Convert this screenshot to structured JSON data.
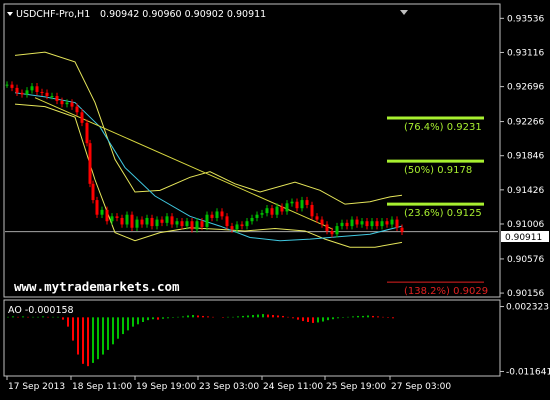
{
  "window": {
    "symbol": "USDCHF-Pro,H1",
    "ohlc": "0.90942 0.90960 0.90902 0.90911",
    "watermark": "www.mytrademarkets.com"
  },
  "colors": {
    "background": "#000000",
    "frame": "#c0c0c0",
    "bull": "#00c000",
    "bear": "#ff0000",
    "bands": "#e6e65a",
    "ma": "#40c8e0",
    "trendline": "#d8d840",
    "fib_level": "#a8f030",
    "fib_ext": "#e02020",
    "price_line": "#c0c0c0"
  },
  "chart_data": [
    {
      "type": "candlestick",
      "title": "USDCHF-Pro,H1",
      "y_ticks": [
        "0.93536",
        "0.93116",
        "0.92696",
        "0.92266",
        "0.91846",
        "0.91426",
        "0.91006",
        "0.90576",
        "0.90156"
      ],
      "ylim": [
        0.9012,
        0.937
      ],
      "x_ticks": [
        "17 Sep 2013",
        "18 Sep 11:00",
        "19 Sep 19:00",
        "23 Sep 03:00",
        "24 Sep 11:00",
        "25 Sep 19:00",
        "27 Sep 03:00"
      ],
      "current_price": "0.90911",
      "price_series": [
        {
          "x": 0,
          "c": 0.9272
        },
        {
          "x": 5,
          "c": 0.9268
        },
        {
          "x": 10,
          "c": 0.9262
        },
        {
          "x": 15,
          "c": 0.926
        },
        {
          "x": 20,
          "c": 0.9265
        },
        {
          "x": 25,
          "c": 0.927
        },
        {
          "x": 30,
          "c": 0.9263
        },
        {
          "x": 35,
          "c": 0.9262
        },
        {
          "x": 40,
          "c": 0.9258
        },
        {
          "x": 45,
          "c": 0.9258
        },
        {
          "x": 50,
          "c": 0.9252
        },
        {
          "x": 55,
          "c": 0.9248
        },
        {
          "x": 60,
          "c": 0.925
        },
        {
          "x": 65,
          "c": 0.9245
        },
        {
          "x": 70,
          "c": 0.9238
        },
        {
          "x": 75,
          "c": 0.9225
        },
        {
          "x": 80,
          "c": 0.92
        },
        {
          "x": 83,
          "c": 0.915
        },
        {
          "x": 86,
          "c": 0.913
        },
        {
          "x": 90,
          "c": 0.9112
        },
        {
          "x": 95,
          "c": 0.9118
        },
        {
          "x": 100,
          "c": 0.9104
        },
        {
          "x": 105,
          "c": 0.911
        },
        {
          "x": 110,
          "c": 0.9108
        },
        {
          "x": 115,
          "c": 0.91
        },
        {
          "x": 120,
          "c": 0.9112
        },
        {
          "x": 125,
          "c": 0.9096
        },
        {
          "x": 130,
          "c": 0.9106
        },
        {
          "x": 135,
          "c": 0.91
        },
        {
          "x": 140,
          "c": 0.9108
        },
        {
          "x": 145,
          "c": 0.9098
        },
        {
          "x": 150,
          "c": 0.9106
        },
        {
          "x": 155,
          "c": 0.9102
        },
        {
          "x": 160,
          "c": 0.911
        },
        {
          "x": 165,
          "c": 0.91
        },
        {
          "x": 170,
          "c": 0.9104
        },
        {
          "x": 175,
          "c": 0.9098
        },
        {
          "x": 180,
          "c": 0.9104
        },
        {
          "x": 185,
          "c": 0.9094
        },
        {
          "x": 190,
          "c": 0.9104
        },
        {
          "x": 195,
          "c": 0.9097
        },
        {
          "x": 200,
          "c": 0.9112
        },
        {
          "x": 205,
          "c": 0.9108
        },
        {
          "x": 210,
          "c": 0.9116
        },
        {
          "x": 215,
          "c": 0.911
        },
        {
          "x": 220,
          "c": 0.9098
        },
        {
          "x": 225,
          "c": 0.9094
        },
        {
          "x": 230,
          "c": 0.91
        },
        {
          "x": 235,
          "c": 0.9098
        },
        {
          "x": 240,
          "c": 0.9104
        },
        {
          "x": 245,
          "c": 0.9108
        },
        {
          "x": 250,
          "c": 0.9112
        },
        {
          "x": 255,
          "c": 0.9114
        },
        {
          "x": 260,
          "c": 0.912
        },
        {
          "x": 265,
          "c": 0.9112
        },
        {
          "x": 270,
          "c": 0.9122
        },
        {
          "x": 275,
          "c": 0.9116
        },
        {
          "x": 280,
          "c": 0.9126
        },
        {
          "x": 285,
          "c": 0.9128
        },
        {
          "x": 290,
          "c": 0.912
        },
        {
          "x": 295,
          "c": 0.913
        },
        {
          "x": 300,
          "c": 0.9124
        },
        {
          "x": 305,
          "c": 0.911
        },
        {
          "x": 310,
          "c": 0.9106
        },
        {
          "x": 315,
          "c": 0.91
        },
        {
          "x": 320,
          "c": 0.9092
        },
        {
          "x": 325,
          "c": 0.9088
        },
        {
          "x": 330,
          "c": 0.9098
        },
        {
          "x": 335,
          "c": 0.9102
        },
        {
          "x": 340,
          "c": 0.9098
        },
        {
          "x": 345,
          "c": 0.9106
        },
        {
          "x": 350,
          "c": 0.91
        },
        {
          "x": 355,
          "c": 0.9104
        },
        {
          "x": 360,
          "c": 0.9098
        },
        {
          "x": 365,
          "c": 0.9104
        },
        {
          "x": 370,
          "c": 0.9098
        },
        {
          "x": 375,
          "c": 0.9104
        },
        {
          "x": 380,
          "c": 0.91
        },
        {
          "x": 385,
          "c": 0.9106
        },
        {
          "x": 390,
          "c": 0.9096
        },
        {
          "x": 395,
          "c": 0.9091
        }
      ],
      "upper_band": [
        {
          "x": 10,
          "v": 0.9308
        },
        {
          "x": 40,
          "v": 0.9312
        },
        {
          "x": 70,
          "v": 0.93
        },
        {
          "x": 90,
          "v": 0.925
        },
        {
          "x": 110,
          "v": 0.918
        },
        {
          "x": 130,
          "v": 0.914
        },
        {
          "x": 155,
          "v": 0.9142
        },
        {
          "x": 185,
          "v": 0.9158
        },
        {
          "x": 205,
          "v": 0.9165
        },
        {
          "x": 230,
          "v": 0.915
        },
        {
          "x": 255,
          "v": 0.914
        },
        {
          "x": 290,
          "v": 0.9152
        },
        {
          "x": 315,
          "v": 0.9142
        },
        {
          "x": 340,
          "v": 0.9125
        },
        {
          "x": 365,
          "v": 0.9128
        },
        {
          "x": 385,
          "v": 0.9134
        },
        {
          "x": 397,
          "v": 0.9136
        }
      ],
      "lower_band": [
        {
          "x": 10,
          "v": 0.9248
        },
        {
          "x": 40,
          "v": 0.9245
        },
        {
          "x": 70,
          "v": 0.9232
        },
        {
          "x": 90,
          "v": 0.9155
        },
        {
          "x": 110,
          "v": 0.909
        },
        {
          "x": 130,
          "v": 0.908
        },
        {
          "x": 155,
          "v": 0.909
        },
        {
          "x": 185,
          "v": 0.9096
        },
        {
          "x": 215,
          "v": 0.9094
        },
        {
          "x": 240,
          "v": 0.9092
        },
        {
          "x": 270,
          "v": 0.9095
        },
        {
          "x": 300,
          "v": 0.9092
        },
        {
          "x": 320,
          "v": 0.9082
        },
        {
          "x": 345,
          "v": 0.9072
        },
        {
          "x": 370,
          "v": 0.9072
        },
        {
          "x": 397,
          "v": 0.9078
        }
      ],
      "moving_average": [
        {
          "x": 10,
          "v": 0.9262
        },
        {
          "x": 40,
          "v": 0.9257
        },
        {
          "x": 70,
          "v": 0.925
        },
        {
          "x": 95,
          "v": 0.922
        },
        {
          "x": 120,
          "v": 0.917
        },
        {
          "x": 150,
          "v": 0.9135
        },
        {
          "x": 185,
          "v": 0.911
        },
        {
          "x": 215,
          "v": 0.9098
        },
        {
          "x": 245,
          "v": 0.9084
        },
        {
          "x": 275,
          "v": 0.908
        },
        {
          "x": 305,
          "v": 0.9082
        },
        {
          "x": 335,
          "v": 0.9085
        },
        {
          "x": 365,
          "v": 0.9088
        },
        {
          "x": 397,
          "v": 0.9098
        }
      ],
      "trendline": [
        {
          "x": 30,
          "v": 0.9256
        },
        {
          "x": 328,
          "v": 0.9094
        }
      ],
      "fibonacci_levels": [
        {
          "label": "(76.4%) 0.9231",
          "value": 0.9231,
          "x_start": 385
        },
        {
          "label": "(50%) 0.9178",
          "value": 0.9178,
          "x_start": 385
        },
        {
          "label": "(23.6%) 0.9125",
          "value": 0.9125,
          "x_start": 385
        },
        {
          "label": "(138.2%) 0.9029",
          "value": 0.9029,
          "x_start": 385
        }
      ]
    },
    {
      "type": "bar",
      "title": "AO -0.000158",
      "y_ticks": [
        "0.002323",
        "-0.011641"
      ],
      "ylim": [
        -0.0124,
        0.0033
      ],
      "values": [
        0.0001,
        0.0002,
        0.0001,
        0.0002,
        0.0001,
        0.0001,
        0.0001,
        0.0002,
        0.0001,
        0.0001,
        0.0001,
        -0.0005,
        -0.002,
        -0.005,
        -0.008,
        -0.01,
        -0.0105,
        -0.0098,
        -0.009,
        -0.008,
        -0.007,
        -0.0058,
        -0.0046,
        -0.0036,
        -0.0028,
        -0.002,
        -0.0015,
        -0.001,
        -0.0006,
        -0.0004,
        -0.0005,
        -0.0003,
        -0.0002,
        -0.0001,
        0.0001,
        0.0002,
        0.0004,
        0.0005,
        0.0004,
        0.0003,
        0.0002,
        0.0001,
        0.0,
        -0.0001,
        0.0001,
        0.0001,
        0.0002,
        0.0003,
        0.0004,
        0.0005,
        0.0006,
        0.0007,
        0.0006,
        0.0005,
        0.0004,
        0.0003,
        0.0001,
        -0.0002,
        -0.0005,
        -0.0008,
        -0.001,
        -0.0012,
        -0.0011,
        -0.0009,
        -0.0006,
        -0.0004,
        -0.0002,
        -0.0001,
        0.0001,
        0.0002,
        0.0003,
        0.0003,
        0.0004,
        0.0003,
        0.0002,
        0.0001,
        -0.0001,
        -0.0002
      ]
    }
  ]
}
